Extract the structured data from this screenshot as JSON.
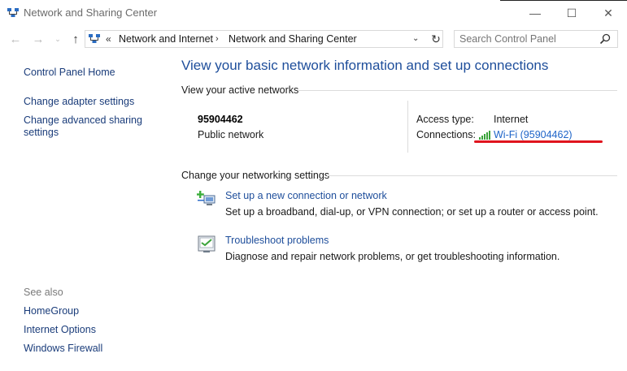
{
  "window": {
    "title": "Network and Sharing Center",
    "minimize_glyph": "—",
    "maximize_glyph": "☐",
    "close_glyph": "✕"
  },
  "nav": {
    "back_glyph": "←",
    "forward_glyph": "→",
    "recent_glyph": "⌄",
    "up_glyph": "↑",
    "chevron": "«",
    "breadcrumbs": [
      "Network and Internet",
      "Network and Sharing Center"
    ],
    "separator": "›",
    "dropdown_glyph": "⌄",
    "refresh_glyph": "↻",
    "search_placeholder": "Search Control Panel"
  },
  "sidebar": {
    "home": "Control Panel Home",
    "links": [
      "Change adapter settings",
      "Change advanced sharing settings"
    ],
    "see_also_label": "See also",
    "see_also": [
      "HomeGroup",
      "Internet Options",
      "Windows Firewall"
    ]
  },
  "main": {
    "title": "View your basic network information and set up connections",
    "active_networks_label": "View your active networks",
    "network": {
      "name": "95904462",
      "category": "Public network",
      "access_type_label": "Access type:",
      "access_type_value": "Internet",
      "connections_label": "Connections:",
      "connection_link": "Wi-Fi (95904462)"
    },
    "change_settings_label": "Change your networking settings",
    "tasks": [
      {
        "link": "Set up a new connection or network",
        "description": "Set up a broadband, dial-up, or VPN connection; or set up a router or access point.",
        "icon": "new-connection-icon"
      },
      {
        "link": "Troubleshoot problems",
        "description": "Diagnose and repair network problems, or get troubleshooting information.",
        "icon": "troubleshoot-icon"
      }
    ]
  },
  "colors": {
    "link": "#1e4e9b",
    "wifi_link": "#1e64c8",
    "highlight": "#e0141e"
  }
}
